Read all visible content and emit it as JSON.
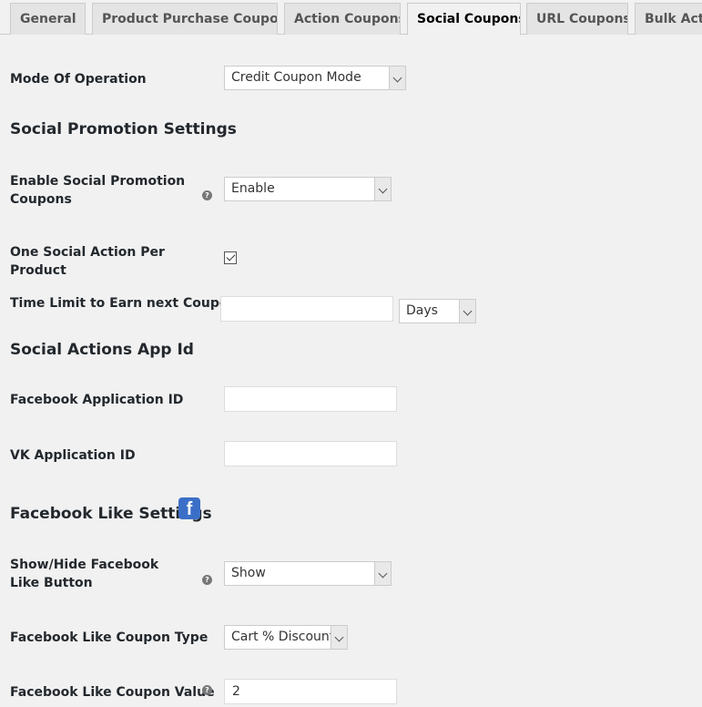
{
  "tabs": [
    {
      "label": "General"
    },
    {
      "label": "Product Purchase Coupons"
    },
    {
      "label": "Action Coupons"
    },
    {
      "label": "Social Coupons"
    },
    {
      "label": "URL Coupons"
    },
    {
      "label": "Bulk Actions"
    }
  ],
  "mode": {
    "label": "Mode Of Operation",
    "value": "Credit Coupon Mode"
  },
  "social_promotion": {
    "heading": "Social Promotion Settings",
    "enable_label": "Enable Social Promotion Coupons",
    "enable_value": "Enable",
    "one_action_label": "One Social Action Per Product",
    "one_action_checked": true,
    "time_limit_label": "Time Limit to Earn next Coupons",
    "time_limit_value": "",
    "time_unit": "Days"
  },
  "app_ids": {
    "heading": "Social Actions App Id",
    "facebook_label": "Facebook Application ID",
    "facebook_value": "",
    "vk_label": "VK Application ID",
    "vk_value": ""
  },
  "facebook_like": {
    "heading": "Facebook Like Settings",
    "icon": "facebook-icon",
    "show_hide_label": "Show/Hide Facebook Like Button",
    "show_hide_value": "Show",
    "coupon_type_label": "Facebook Like Coupon Type",
    "coupon_type_value": "Cart % Discount",
    "coupon_value_label": "Facebook Like Coupon Value",
    "coupon_value": "2"
  },
  "help_glyph": "?",
  "colors": {
    "background": "#f1f1f1",
    "facebook_blue": "#3b6fc7"
  }
}
